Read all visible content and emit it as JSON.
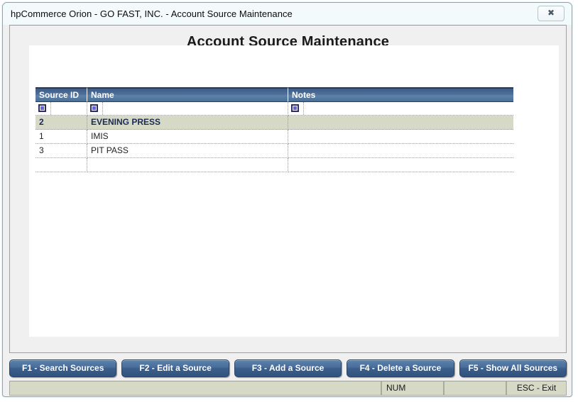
{
  "window": {
    "title": "hpCommerce Orion - GO FAST, INC. - Account Source Maintenance",
    "close_glyph": "✖",
    "close_icon": "close-icon"
  },
  "page": {
    "heading": "Account Source Maintenance"
  },
  "grid": {
    "columns": [
      {
        "label": "Source ID",
        "key": "source_id"
      },
      {
        "label": "Name",
        "key": "name"
      },
      {
        "label": "Notes",
        "key": "notes"
      }
    ],
    "filter_row": {
      "icon_name": "filter-builder-icon",
      "cells": [
        "",
        "",
        ""
      ]
    },
    "rows": [
      {
        "source_id": "2",
        "name": "EVENING PRESS",
        "notes": "",
        "selected": true
      },
      {
        "source_id": "1",
        "name": "IMIS",
        "notes": "",
        "selected": false
      },
      {
        "source_id": "3",
        "name": "PIT PASS",
        "notes": "",
        "selected": false
      }
    ],
    "empty_row_count": 1
  },
  "buttons": [
    {
      "label": "F1 - Search Sources",
      "name": "f1-search-sources-button"
    },
    {
      "label": "F2 - Edit a Source",
      "name": "f2-edit-a-source-button"
    },
    {
      "label": "F3 - Add a Source",
      "name": "f3-add-a-source-button"
    },
    {
      "label": "F4 - Delete a Source",
      "name": "f4-delete-a-source-button"
    },
    {
      "label": "F5 - Show All Sources",
      "name": "f5-show-all-sources-button"
    }
  ],
  "status_bar": {
    "panels": [
      "",
      "NUM",
      "",
      "ESC - Exit"
    ]
  },
  "colors": {
    "header_blue": "#4f7099",
    "header_blue_dark": "#27395c",
    "selected_row": "#d5d9c6",
    "button_blue": "#4b6f9c",
    "status_bg": "#d5d9c6",
    "window_border": "#8aa8b4",
    "title_bar_bg": "#f2fafc",
    "client_bg": "#f0f0f0",
    "panel_bg": "#ffffff"
  }
}
